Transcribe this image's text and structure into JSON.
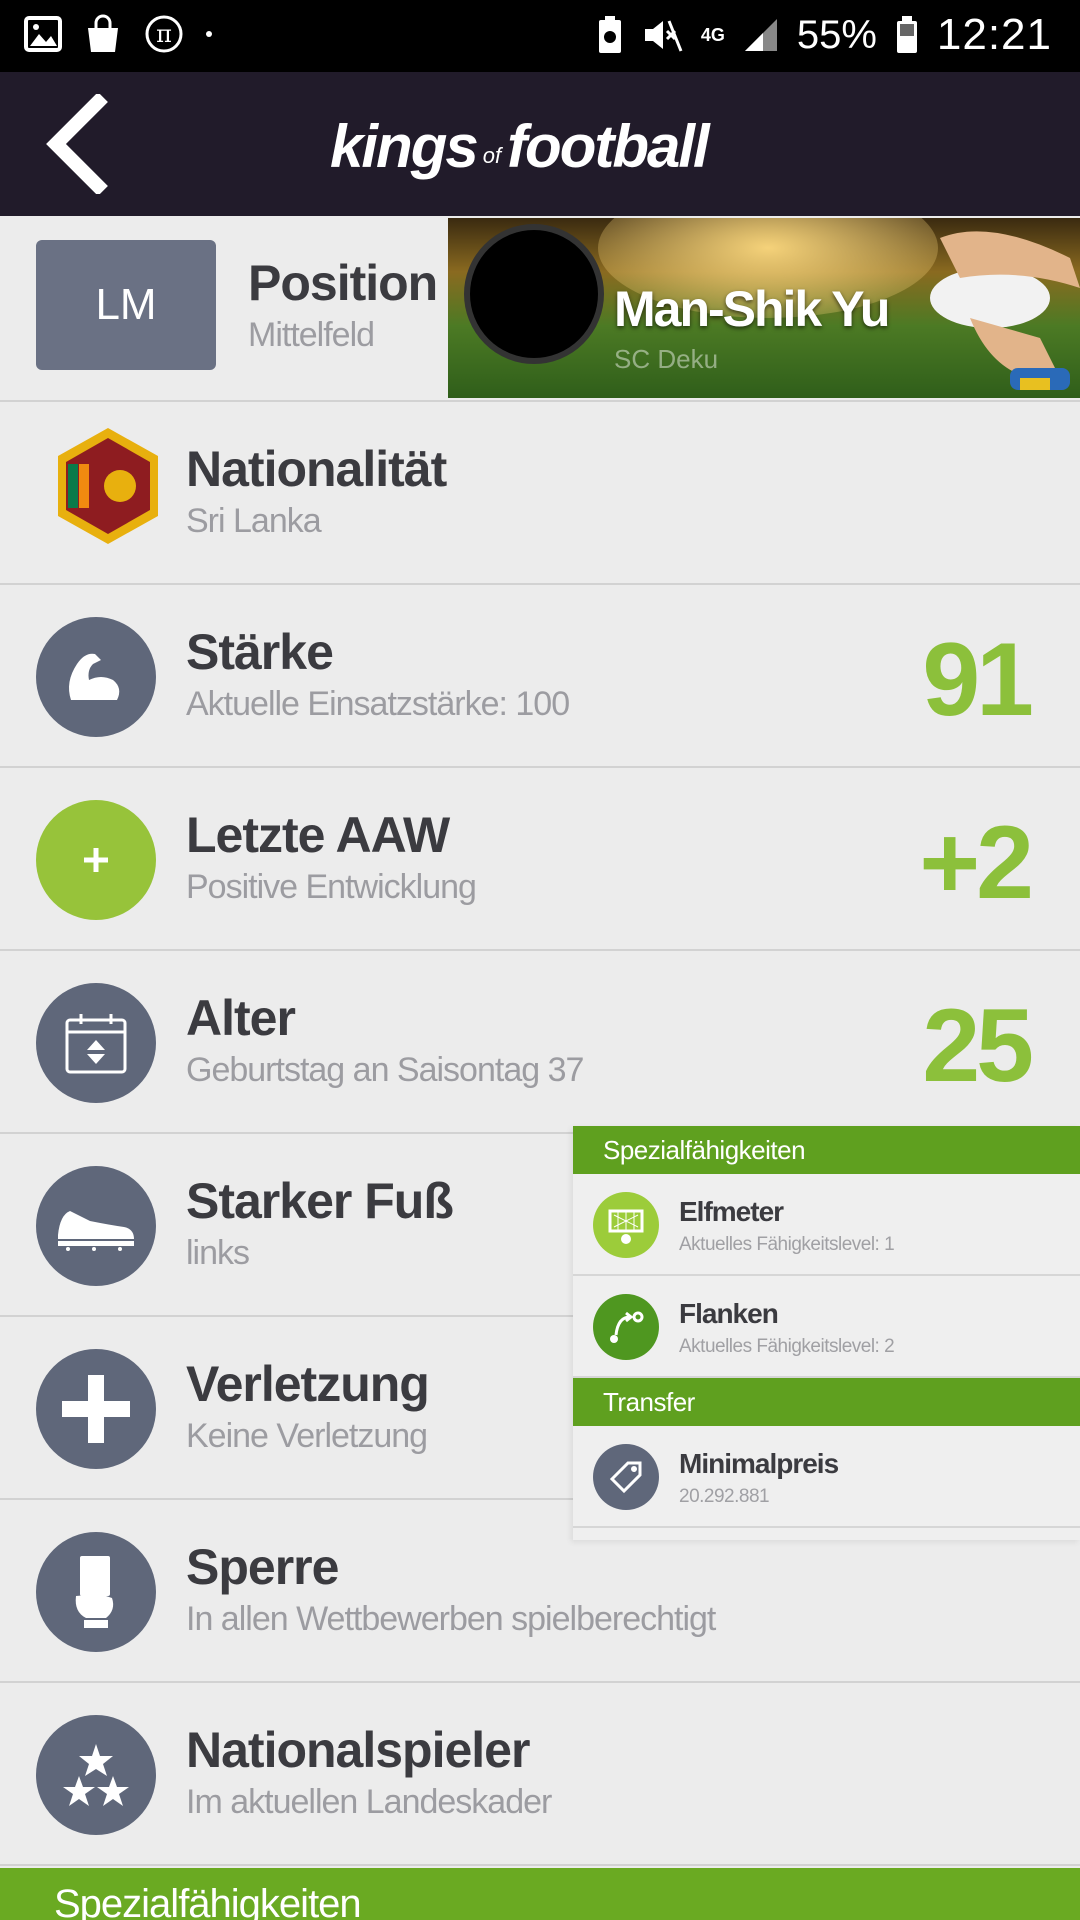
{
  "status_bar": {
    "network": "4G",
    "battery_pct": "55%",
    "time": "12:21",
    "icons": [
      "image-icon",
      "bag-icon",
      "pi-icon",
      "dot-icon",
      "battery-saver-icon",
      "mute-icon",
      "signal-icon",
      "battery-icon"
    ]
  },
  "header": {
    "logo_part1": "kings",
    "logo_of": "of",
    "logo_part2": "football",
    "back_icon": "chevron-left-icon"
  },
  "player": {
    "name": "Man-Shik Yu",
    "club": "SC Deku"
  },
  "position": {
    "badge": "LM",
    "title": "Position",
    "sub": "Mittelfeld"
  },
  "rows": [
    {
      "title": "Nationalität",
      "sub": "Sri Lanka",
      "icon": "flag-icon"
    },
    {
      "title": "Stärke",
      "sub": "Aktuelle Einsatzstärke: 100",
      "value": "91",
      "icon": "muscle-icon"
    },
    {
      "title": "Letzte AAW",
      "sub": "Positive Entwicklung",
      "value": "+2",
      "icon": "plus-icon"
    },
    {
      "title": "Alter",
      "sub": "Geburtstag an Saisontag 37",
      "value": "25",
      "icon": "calendar-icon"
    },
    {
      "title": "Starker Fuß",
      "sub": "links",
      "icon": "shoe-icon"
    },
    {
      "title": "Verletzung",
      "sub": "Keine Verletzung",
      "icon": "cross-icon"
    },
    {
      "title": "Sperre",
      "sub": "In allen Wettbewerben spielberechtigt",
      "icon": "card-icon"
    },
    {
      "title": "Nationalspieler",
      "sub": "Im aktuellen Landeskader",
      "icon": "stars-icon"
    }
  ],
  "panel": {
    "special_header": "Spezialfähigkeiten",
    "special": [
      {
        "title": "Elfmeter",
        "sub": "Aktuelles Fähigkeitslevel: 1",
        "icon": "goal-icon"
      },
      {
        "title": "Flanken",
        "sub": "Aktuelles Fähigkeitslevel: 2",
        "icon": "cross-pass-icon"
      }
    ],
    "transfer_header": "Transfer",
    "transfer": [
      {
        "title": "Minimalpreis",
        "sub": "20.292.881",
        "icon": "price-tag-icon"
      }
    ]
  },
  "bottom_header": "Spezialfähigkeiten",
  "colors": {
    "appbar": "#211b2a",
    "accent_green": "#8cc03b",
    "icon_gray": "#5f677a",
    "section_green": "#5fa01f"
  }
}
